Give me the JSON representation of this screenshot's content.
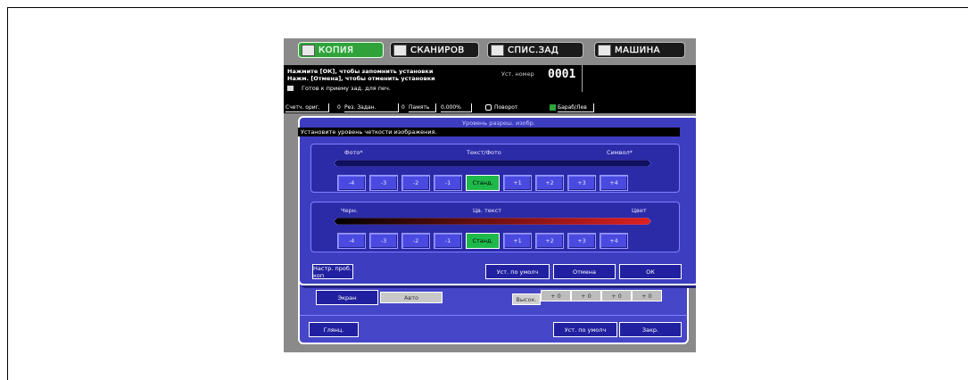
{
  "tabs": [
    {
      "label": "КОПИЯ",
      "icon": "copy-icon",
      "active": true
    },
    {
      "label": "СКАНИРОВ",
      "icon": "scan-icon",
      "active": false
    },
    {
      "label": "СПИС.ЗАД",
      "icon": "job-list-icon",
      "active": false
    },
    {
      "label": "МАШИНА",
      "icon": "machine-icon",
      "active": false
    }
  ],
  "message": {
    "line1": "Нажмите [ОК], чтобы запомнить установки",
    "line2": "Нажм. [Отмена], чтобы отменить установки",
    "line3": "Готов к приему зад. для печ.",
    "set_number_label": "Уст. номер",
    "set_number": "0001"
  },
  "status_bar": {
    "orig_counter": "Счетч. ориг.",
    "orig_value": "0",
    "reserved": "Рез. Задан.",
    "reserved_value": "0",
    "memory": "Память",
    "memory_value": "0.000%",
    "rotate": "Поворот",
    "drum": "Бараб/Лев"
  },
  "dialog": {
    "title": "Уровень разреш. изобр.",
    "instruction": "Установите уровень четкости изображения.",
    "row1": {
      "left": "Фото*",
      "center": "Текст/Фото",
      "right": "Символ*",
      "buttons": [
        "-4",
        "-3",
        "-2",
        "-1",
        "Станд.",
        "+1",
        "+2",
        "+3",
        "+4"
      ],
      "selected": "Станд."
    },
    "row2": {
      "left": "Черн.",
      "center": "Цв. текст",
      "right": "Цвет",
      "buttons": [
        "-4",
        "-3",
        "-2",
        "-1",
        "Станд.",
        "+1",
        "+2",
        "+3",
        "+4"
      ],
      "selected": "Станд."
    },
    "test_copy": "Настр. проб. коп",
    "default": "Уст. по умолч",
    "cancel": "Отмена",
    "ok": "ОК"
  },
  "back_panel": {
    "screen": "Экран",
    "auto": "Авто",
    "high": "Высок.",
    "values": [
      "+ 0",
      "+ 0",
      "+ 0",
      "+ 0"
    ],
    "gloss": "Глянц.",
    "default": "Уст. по умолч",
    "close": "Закр."
  },
  "colors": {
    "panel_blue": "#3d3dc0",
    "active_green": "#1fb84a",
    "background_gray": "#8a8a8a"
  }
}
